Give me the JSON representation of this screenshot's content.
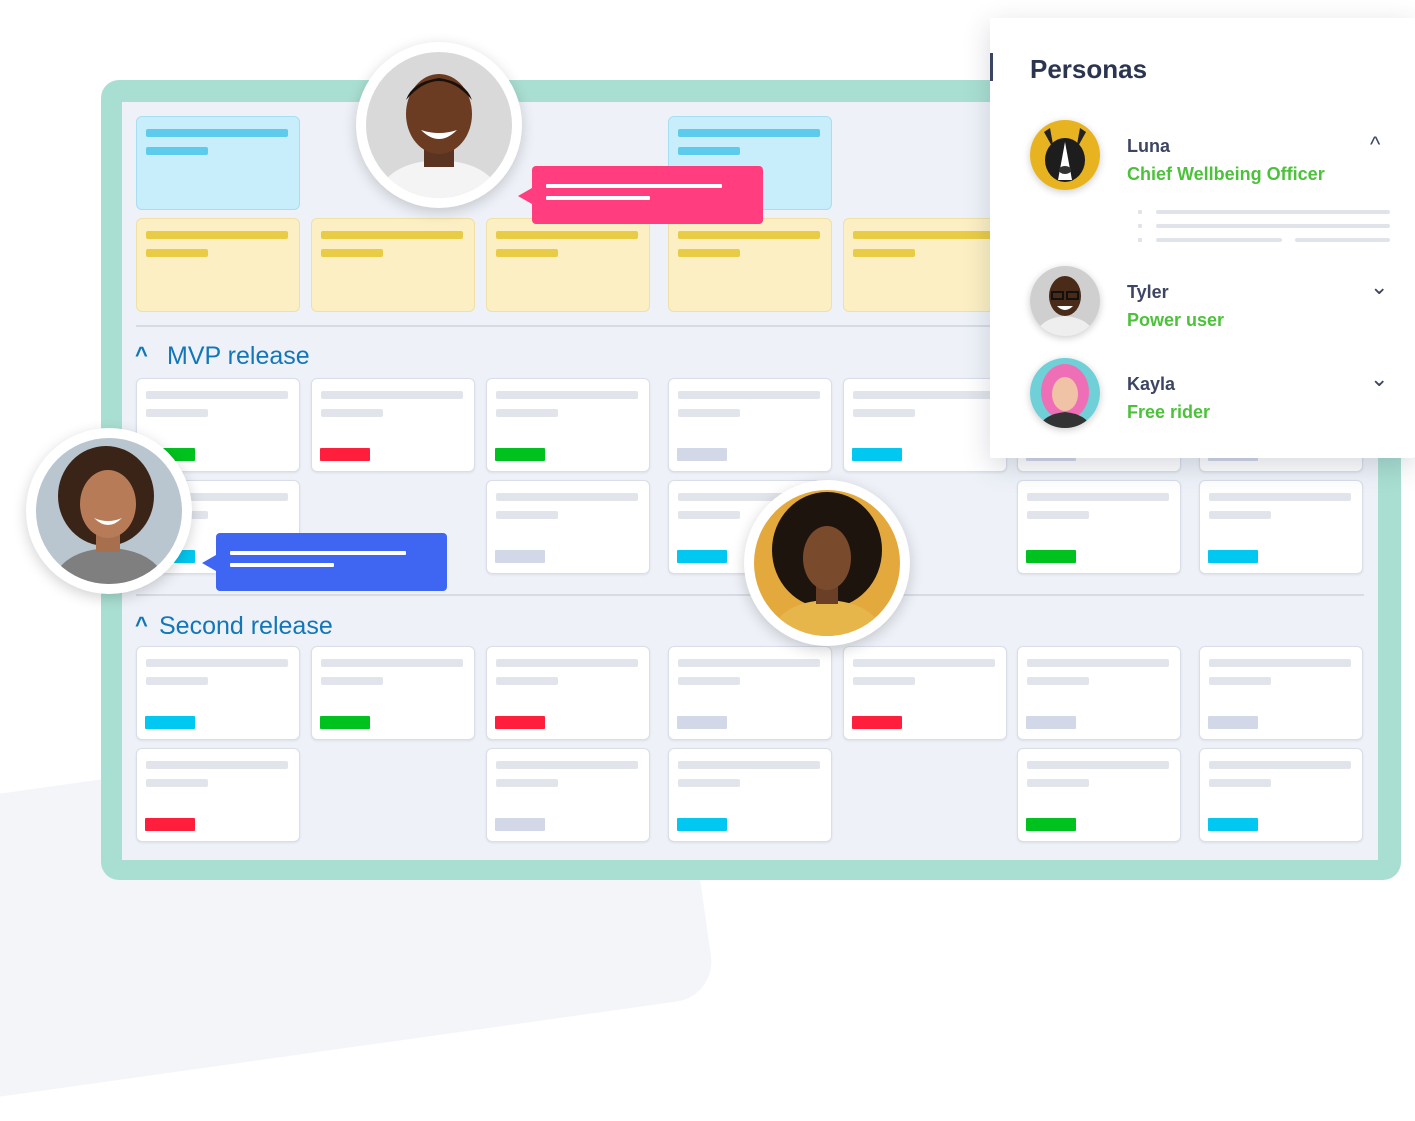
{
  "sections": [
    {
      "title": "MVP release",
      "caret": "^"
    },
    {
      "title": "Second release",
      "caret": "^"
    }
  ],
  "panel": {
    "title": "Personas",
    "personas": [
      {
        "name": "Luna",
        "role": "Chief Wellbeing Officer",
        "chevron": "^",
        "expanded": true
      },
      {
        "name": "Tyler",
        "role": "Power user",
        "chevron": "⌄",
        "expanded": false
      },
      {
        "name": "Kayla",
        "role": "Free rider",
        "chevron": "⌄",
        "expanded": false
      }
    ]
  },
  "colors": {
    "accent": "#1276b8",
    "role_green": "#4cc23a",
    "frame": "#a9dfd2",
    "tag_green": "#00c21f",
    "tag_red": "#ff1f3d",
    "tag_cyan": "#00c8f0",
    "tag_gray": "#d2d8e8",
    "bubble_pink": "#ff3d7f",
    "bubble_blue": "#3f66f2"
  },
  "board": {
    "mvp_row1_tags": [
      "green",
      "red",
      "green",
      "gray",
      "cyan",
      "gray",
      "gray"
    ],
    "mvp_row2_tags": [
      "cyan",
      "",
      "gray",
      "cyan",
      "",
      "green",
      "cyan"
    ],
    "second_row1_tags": [
      "cyan",
      "green",
      "red",
      "gray",
      "red",
      "gray",
      "gray"
    ],
    "second_row2_tags": [
      "red",
      "",
      "gray",
      "cyan",
      "",
      "green",
      "cyan"
    ]
  }
}
